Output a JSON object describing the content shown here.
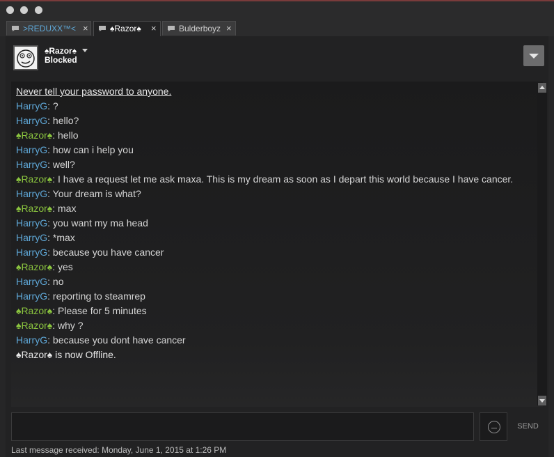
{
  "tabs": [
    {
      "label": ">REDUXX™<",
      "close": "×",
      "style": "blue"
    },
    {
      "label": "♠Razor♠",
      "close": "×",
      "style": "active"
    },
    {
      "label": "Bulderboyz",
      "close": "×",
      "style": "normal"
    }
  ],
  "friend": {
    "name": "♠Razor♠",
    "status": "Blocked"
  },
  "messages": [
    {
      "type": "system",
      "text": "Never tell your password to anyone."
    },
    {
      "type": "msg",
      "sender": "HarryG",
      "text": ": ?"
    },
    {
      "type": "msg",
      "sender": "HarryG",
      "text": ": hello?"
    },
    {
      "type": "msg",
      "sender": "♠Razor♠",
      "text": ": hello"
    },
    {
      "type": "msg",
      "sender": "HarryG",
      "text": ": how can i help you"
    },
    {
      "type": "msg",
      "sender": "HarryG",
      "text": ": well?"
    },
    {
      "type": "msg",
      "sender": "♠Razor♠",
      "text": ": I have a request let me ask maxa. This is my dream as soon as I depart this world because I have cancer."
    },
    {
      "type": "msg",
      "sender": "HarryG",
      "text": ": Your dream is what?"
    },
    {
      "type": "msg",
      "sender": "♠Razor♠",
      "text": ": max"
    },
    {
      "type": "msg",
      "sender": "HarryG",
      "text": ": you want my ma head"
    },
    {
      "type": "msg",
      "sender": "HarryG",
      "text": ": *max"
    },
    {
      "type": "msg",
      "sender": "HarryG",
      "text": ": because you have cancer"
    },
    {
      "type": "msg",
      "sender": "♠Razor♠",
      "text": ": yes"
    },
    {
      "type": "msg",
      "sender": "HarryG",
      "text": ": no"
    },
    {
      "type": "msg",
      "sender": "HarryG",
      "text": ": reporting to steamrep"
    },
    {
      "type": "msg",
      "sender": "♠Razor♠",
      "text": ": Please for 5 minutes"
    },
    {
      "type": "msg",
      "sender": "♠Razor♠",
      "text": ": why ?"
    },
    {
      "type": "msg",
      "sender": "HarryG",
      "text": ": because you dont have cancer"
    },
    {
      "type": "offline",
      "text": "♠Razor♠ is now Offline."
    }
  ],
  "input": {
    "send_label": "SEND",
    "emoji_icon": "emoticon-icon"
  },
  "footer": {
    "last_message": "Last message received: Monday, June 1, 2015 at 1:26 PM"
  },
  "colors": {
    "harry": "#5fa8d8",
    "razor": "#8bc53f",
    "tab_blue": "#5fa8d8"
  }
}
